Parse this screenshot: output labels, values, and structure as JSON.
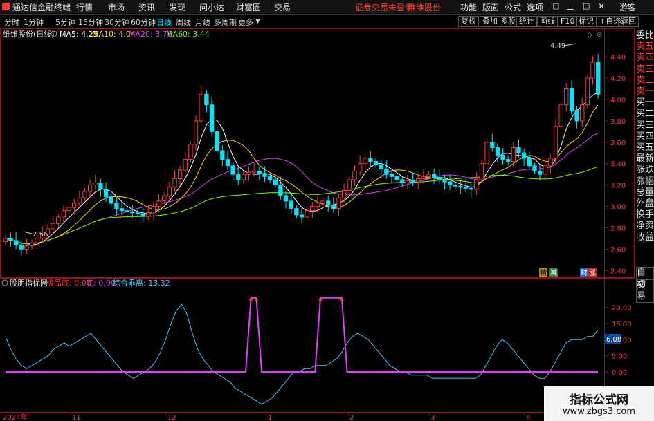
{
  "menubar": {
    "app_title": "通达信金融终端",
    "items": [
      "行情",
      "市场",
      "资讯",
      "发现",
      "问小达",
      "财富圈",
      "交易"
    ],
    "alert_text": "证券交易未登录",
    "stock_name": "维维股份",
    "right_items": [
      "功能",
      "版面",
      "公式",
      "选项"
    ],
    "user": "游客"
  },
  "periodbar": {
    "items": [
      "分时",
      "1分钟",
      "5分钟",
      "15分钟",
      "30分钟",
      "60分钟",
      "日线",
      "周线",
      "月线",
      "多周期",
      "更多"
    ],
    "active": "日线",
    "right_buttons": [
      "复权",
      "叠加",
      "多股",
      "统计",
      "画线",
      "F10",
      "标记",
      "+自选",
      "返回"
    ]
  },
  "main_chart": {
    "title": "维维股份(日线)",
    "ma_labels": [
      {
        "text": "MA5: 4.25",
        "color": "#ffffff"
      },
      {
        "text": "MA10: 4.04",
        "color": "#ffd700"
      },
      {
        "text": "MA20: 3.76",
        "color": "#e040fb"
      },
      {
        "text": "MA60: 3.44",
        "color": "#7cfc00"
      }
    ],
    "high_label": "4.49",
    "low_label": "2.56",
    "y_ticks": [
      "4.40",
      "4.20",
      "4.00",
      "3.80",
      "3.60",
      "3.40",
      "3.20",
      "3.00",
      "2.80",
      "2.60",
      "2.40"
    ],
    "bottom_tags": [
      "精",
      "减",
      "财",
      "涨"
    ]
  },
  "chart_data": {
    "type": "candlestick",
    "title": "维维股份(日线)",
    "ylim": [
      2.35,
      4.55
    ],
    "x_labels": [
      "2024年",
      "11",
      "12",
      "1",
      "2",
      "3",
      "4"
    ],
    "closes": [
      2.7,
      2.68,
      2.64,
      2.6,
      2.63,
      2.66,
      2.7,
      2.74,
      2.79,
      2.84,
      2.9,
      2.96,
      2.99,
      3.03,
      3.08,
      3.14,
      3.2,
      3.22,
      3.16,
      3.09,
      3.03,
      2.98,
      2.96,
      2.95,
      2.94,
      2.93,
      2.91,
      2.94,
      3.0,
      3.05,
      3.1,
      3.18,
      3.26,
      3.34,
      3.44,
      3.58,
      3.8,
      4.05,
      3.95,
      3.7,
      3.52,
      3.44,
      3.38,
      3.3,
      3.25,
      3.3,
      3.32,
      3.33,
      3.31,
      3.28,
      3.25,
      3.2,
      3.1,
      3.05,
      2.98,
      2.92,
      2.9,
      2.96,
      3.0,
      3.03,
      3.05,
      3.01,
      2.98,
      3.08,
      3.15,
      3.25,
      3.33,
      3.4,
      3.45,
      3.42,
      3.39,
      3.35,
      3.3,
      3.28,
      3.25,
      3.22,
      3.24,
      3.23,
      3.26,
      3.28,
      3.3,
      3.27,
      3.25,
      3.23,
      3.2,
      3.19,
      3.18,
      3.17,
      3.16,
      3.25,
      3.4,
      3.6,
      3.55,
      3.48,
      3.44,
      3.42,
      3.55,
      3.5,
      3.45,
      3.38,
      3.33,
      3.3,
      3.38,
      3.45,
      3.75,
      3.95,
      4.1,
      3.9,
      3.8,
      3.95,
      4.2,
      4.35,
      4.05
    ],
    "ma_last": {
      "MA5": 4.25,
      "MA10": 4.04,
      "MA20": 3.76,
      "MA60": 3.44
    },
    "max_price": 4.49,
    "min_price": 2.56
  },
  "indicator": {
    "title": "股朋指标网",
    "labels": [
      {
        "text": "极品底: 0.00",
        "color": "#ff3b30"
      },
      {
        "text": "底: 0.00",
        "color": "#e040fb"
      },
      {
        "text": "综合乖离: 13.32",
        "color": "#4fc3f7"
      }
    ],
    "y_ticks": [
      "20.00",
      "15.00",
      "10.00",
      "5.00",
      "0.00"
    ],
    "current_value": "6.08",
    "values": [
      11,
      7,
      4,
      2,
      1,
      2,
      3,
      4,
      5,
      7,
      8,
      9,
      8,
      9,
      10,
      11,
      12,
      10,
      8,
      6,
      4,
      2,
      0,
      -1,
      -2,
      -1,
      0,
      1,
      3,
      6,
      10,
      15,
      19,
      21,
      18,
      12,
      7,
      4,
      2,
      0,
      -1,
      -2,
      -3,
      -5,
      -6,
      -7,
      -8,
      -9,
      -10,
      -9,
      -8,
      -6,
      -4,
      -2,
      0,
      0,
      1,
      1,
      2,
      2,
      2,
      3,
      4,
      6,
      9,
      11,
      12,
      11,
      10,
      8,
      6,
      4,
      2,
      1,
      0,
      0,
      -1,
      -1,
      -1,
      -1,
      -2,
      -2,
      -2,
      -2,
      -2,
      -2,
      -2,
      -2,
      -2,
      -1,
      2,
      5,
      8,
      10,
      9,
      7,
      5,
      3,
      1,
      -1,
      -2,
      -2,
      0,
      3,
      6,
      9,
      10,
      10,
      10,
      11,
      11,
      13
    ],
    "spikes": [
      {
        "from": 45,
        "to": 48,
        "value": 23
      },
      {
        "from": 58,
        "to": 64,
        "value": 23
      }
    ]
  },
  "side_panel": {
    "items": [
      "委比",
      "卖五",
      "卖四",
      "卖三",
      "卖二",
      "卖一",
      "买一",
      "买二",
      "买三",
      "买四",
      "买五",
      "最新",
      "涨跌",
      "涨幅",
      "总量",
      "外盘",
      "换手",
      "净资",
      "收益"
    ],
    "buttons": [
      "自动",
      "交易"
    ]
  },
  "watermark": {
    "title": "指标公式网",
    "url": "www.zbgs3.com"
  },
  "colors": {
    "up": "#ff3b3b",
    "down": "#00e5ff",
    "ma5": "#ffffff",
    "ma10": "#ffd700",
    "ma20": "#e040fb",
    "ma60": "#7cfc00",
    "deviation": "#4fc3f7",
    "bottom_signal": "#e040fb"
  }
}
